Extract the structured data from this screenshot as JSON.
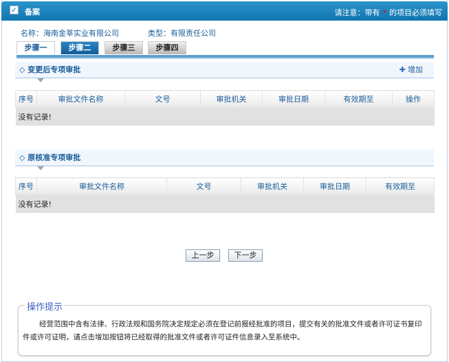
{
  "header": {
    "title": "备案",
    "note_prefix": "请注意：带有",
    "note_star": "*",
    "note_suffix": "的项目必须填写"
  },
  "info": {
    "name": "名称：海南金莘实业有限公司",
    "type": "类型：有限责任公司"
  },
  "tabs": [
    {
      "label": "步骤一"
    },
    {
      "label": "步骤二"
    },
    {
      "label": "步骤三"
    },
    {
      "label": "步骤四"
    }
  ],
  "section1": {
    "title": "◇ 变更后专项审批",
    "add_label": "增加",
    "columns": [
      "序号",
      "审批文件名称",
      "文号",
      "审批机关",
      "审批日期",
      "有效期至",
      "操作"
    ],
    "empty": "没有记录!"
  },
  "section2": {
    "title": "◇ 原核准专项审批",
    "columns": [
      "序号",
      "审批文件名称",
      "文号",
      "审批机关",
      "审批日期",
      "有效期至"
    ],
    "empty": "没有记录!"
  },
  "buttons": {
    "prev": "上一步",
    "next": "下一步"
  },
  "tips": {
    "title": "操作提示",
    "text": "经营范围中含有法律、行政法规和国务院决定规定必须在登记前报经批准的项目，提交有关的批准文件或者许可证书复印件或许可证明，请点击增加按钮将已经取得的批准文件或者许可证件信息录入至系统中。"
  }
}
